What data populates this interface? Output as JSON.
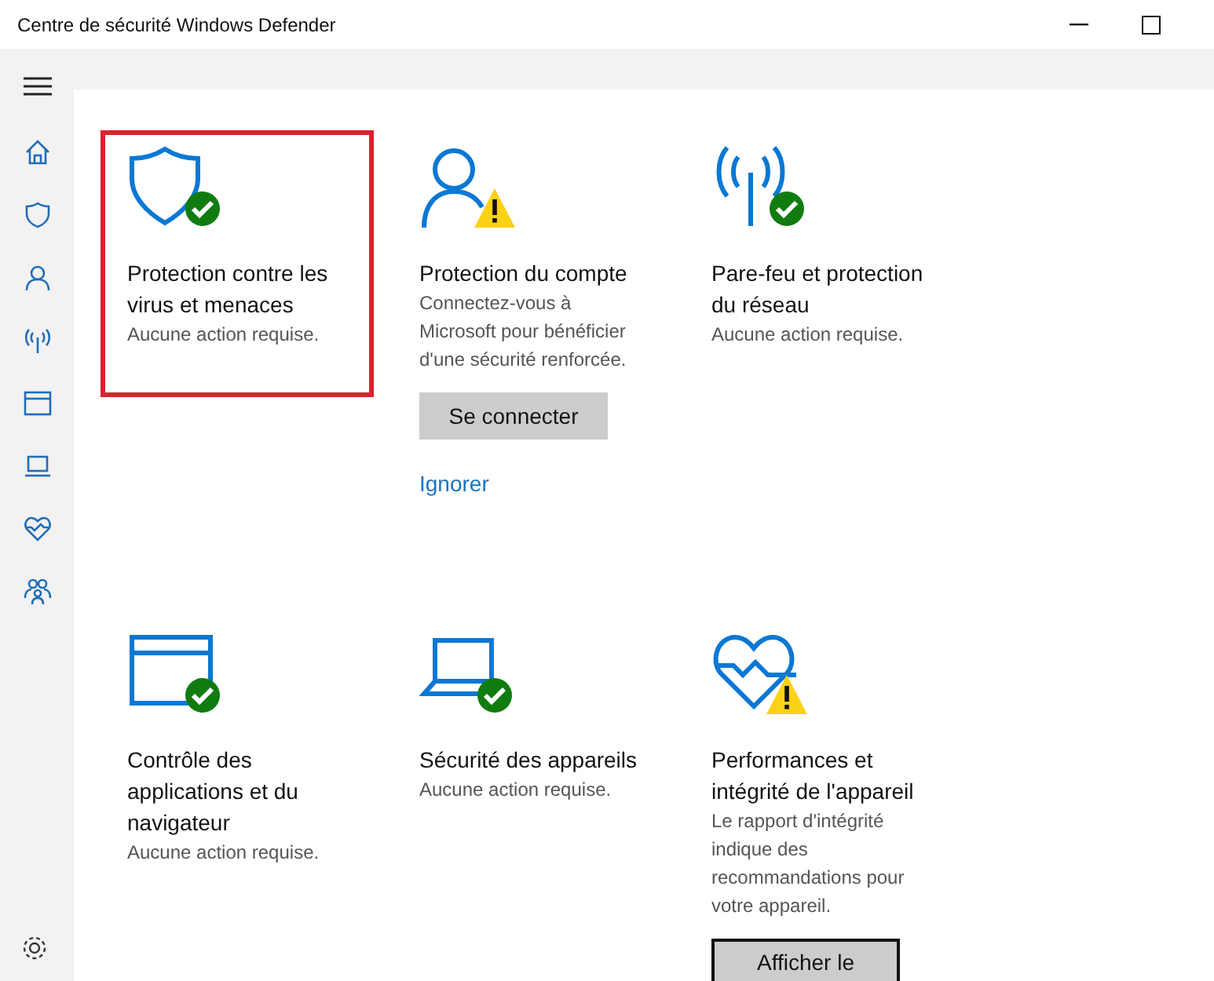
{
  "window": {
    "title": "Centre de sécurité Windows Defender"
  },
  "tiles": [
    {
      "title": "Protection contre les virus et menaces",
      "description": "Aucune action requise.",
      "warning": false,
      "highlighted": true
    },
    {
      "title": "Protection du compte",
      "description": "Connectez-vous à Microsoft pour bénéficier d'une sécurité renforcée.",
      "warning": true,
      "highlighted": false,
      "button": {
        "label": "Se connecter",
        "focused": false
      },
      "link": "Ignorer"
    },
    {
      "title": "Pare-feu et protection du réseau",
      "description": "Aucune action requise.",
      "warning": false,
      "highlighted": false
    },
    {
      "title": "Contrôle des applications et du navigateur",
      "description": "Aucune action requise.",
      "warning": false,
      "highlighted": false
    },
    {
      "title": "Sécurité des appareils",
      "description": "Aucune action requise.",
      "warning": false,
      "highlighted": false
    },
    {
      "title": "Performances et intégrité de l'appareil",
      "description": "Le rapport d'intégrité indique des recommandations pour votre appareil.",
      "warning": true,
      "highlighted": false,
      "button": {
        "label": "Afficher le",
        "focused": true
      }
    }
  ]
}
